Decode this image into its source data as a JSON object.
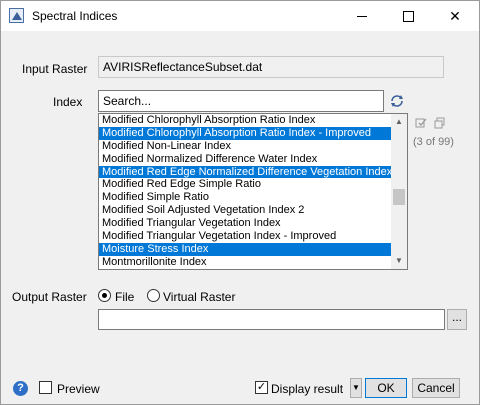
{
  "window": {
    "title": "Spectral Indices",
    "minimize_glyph": "",
    "maximize_glyph": "",
    "close_glyph": "✕"
  },
  "form": {
    "input_raster_label": "Input Raster",
    "input_raster_value": "AVIRISReflectanceSubset.dat",
    "index_label": "Index",
    "search_placeholder": "Search...",
    "count_text": "(3 of 99)",
    "index_items": [
      {
        "label": "Modified Chlorophyll Absorption Ratio Index",
        "selected": false
      },
      {
        "label": "Modified Chlorophyll Absorption Ratio Index - Improved",
        "selected": true
      },
      {
        "label": "Modified Non-Linear Index",
        "selected": false
      },
      {
        "label": "Modified Normalized Difference Water Index",
        "selected": false
      },
      {
        "label": "Modified Red Edge Normalized Difference Vegetation Index",
        "selected": true
      },
      {
        "label": "Modified Red Edge Simple Ratio",
        "selected": false
      },
      {
        "label": "Modified Simple Ratio",
        "selected": false
      },
      {
        "label": "Modified Soil Adjusted Vegetation Index 2",
        "selected": false
      },
      {
        "label": "Modified Triangular Vegetation Index",
        "selected": false
      },
      {
        "label": "Modified Triangular Vegetation Index - Improved",
        "selected": false
      },
      {
        "label": "Moisture Stress Index",
        "selected": true
      },
      {
        "label": "Montmorillonite Index",
        "selected": false
      }
    ],
    "output_raster_label": "Output Raster",
    "output_options": [
      "File",
      "Virtual Raster"
    ],
    "output_selected": "File",
    "output_value": "",
    "browse_label": "..."
  },
  "footer": {
    "help_glyph": "?",
    "preview_label": "Preview",
    "preview_checked": false,
    "display_result_label": "Display result",
    "display_result_checked": true,
    "ok_label": "OK",
    "cancel_label": "Cancel"
  },
  "colors": {
    "selection": "#0078d7",
    "window_bg": "#f0f0f0"
  }
}
